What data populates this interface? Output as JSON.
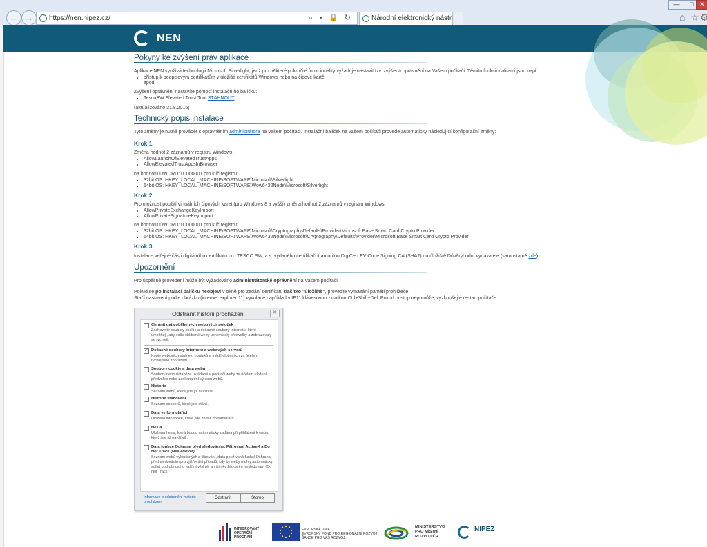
{
  "browser": {
    "url": "https://nen.nipez.cz/",
    "tab_title": "Národní elektronický nástroj",
    "tab_close": "×",
    "address_tools": "⌕ ▾ 🔒 ↻",
    "win_min": "—",
    "win_max": "□",
    "win_close": "✕",
    "back_glyph": "←",
    "forward_glyph": "→"
  },
  "header": {
    "logo_text": "NEN"
  },
  "section1": {
    "title": "Pokyny ke zvýšení práv aplikace",
    "intro": "Aplikace NEN využívá technologii Microsoft Silverlight, jenž pro některé pokročilé funkcionality vyžaduje nastavit tzv. zvýšená oprávnění na Vašem počítači. Těmito funkcionalitami jsou např.",
    "bullet1_line1": "přístup k podpisovým certifikátům v úložišti certifikátů Windows nebo na čipové kartě",
    "bullet1_line2": "apod.",
    "install_text": "Zvýšení oprávnění nastavíte pomocí instalačního balíčku:",
    "tool_text": "TescoSW Elevated Trust Tool ",
    "download_link": "STÁHNOUT",
    "updated": "(aktualizováno 31.8.2016)"
  },
  "section2": {
    "title": "Technický popis instalace",
    "intro_before": "Tyto změny je nutné provádět s oprávněním ",
    "intro_link": "administrátora",
    "intro_after": " na Vašem počítači. Instalační balíček na vašem počítači provede automaticky následující konfigurační změny:",
    "step1": {
      "title": "Krok 1",
      "text": "Změna hodnot 2 záznamů v registru Windows:",
      "items": [
        "AllowLaunchOfElevatedTrustApps",
        "AllowElevatedTrustAppsInBrowser"
      ],
      "value_text": "na hodnotu DWORD: 00000001 pro klíč registru:",
      "keys": [
        "32bit OS: HKEY_LOCAL_MACHINE\\SOFTWARE\\Microsoft\\Silverlight",
        "64bit OS: HKEY_LOCAL_MACHINE\\SOFTWARE\\Wow6432Node\\Microsoft\\Silverlight"
      ]
    },
    "step2": {
      "title": "Krok 2",
      "text": "Pro možnost použití virtuálních čipových karet (pro Windows 8 a vyšší) změna hodnot 2 záznamů v registru Windows:",
      "items": [
        "AllowPrivateExchangeKeyImport",
        "AllowPrivateSignatureKeyImport"
      ],
      "value_text": "na hodnotu DWORD: 00000001 pro klíč registru:",
      "keys": [
        "32bit OS: HKEY_LOCAL_MACHINE\\SOFTWARE\\Microsoft\\Cryptography\\Defaults\\Provider\\Microsoft Base Smart Card Crypto Provider",
        "64bit OS: HKEY_LOCAL_MACHINE\\SOFTWARE\\Wow6432Node\\Microsoft\\Cryptography\\Defaults\\Provider\\Microsoft Base Smart Card Crypto Provider"
      ]
    },
    "step3": {
      "title": "Krok 3",
      "text_before": "Instalace veřejné části digitálního certifikátu pro TESCO SW, a.s. vydaného certifikační autoritou DigiCert EV Code Signing CA (SHA2) do úložiště Důvěryhodní vydavatelé (samostatně ",
      "link": "zde",
      "text_after": ")."
    }
  },
  "section3": {
    "title": "Upozornění",
    "p1_before": "Pro úspěšné provedení může být vyžadováno ",
    "p1_bold": "administrátorské oprávnění",
    "p1_after": " na Vašem počítači.",
    "p2_a": "Pokud se ",
    "p2_bold1": "po instalaci balíčku neobjeví",
    "p2_b": " v okně pro zadání certifikátu ",
    "p2_bold2": "tlačítko \"úložiště\"",
    "p2_c": ", proveďte vymazání paměti prohlížeče.",
    "p3": "Stačí nastavení podle obrázku (internet explorer 11) vyvolané například v IE11 klávesovou zkratkou Ctrl+Shift+Del. Pokud postup nepomůže, vyzkoušejte restart počítače."
  },
  "dialog": {
    "title": "Odstranit historii procházení",
    "close": "✕",
    "options": [
      {
        "label": "Chránit data oblíbených webových položek",
        "checked": false,
        "desc": "Zachovejte soubory cookie a dočasné soubory Internetu, které umožňují, aby vaše oblíbené weby uchovávaly předvolby a zobrazovaly se rychleji."
      },
      {
        "label": "Dočasné soubory Internetu a webových serverů",
        "checked": true,
        "desc": "Kopie webových stránek, obrázků a médií uložených za účelem rychlejšího zobrazení."
      },
      {
        "label": "Soubory cookie a data webu",
        "checked": false,
        "desc": "Soubory nebo databáze ukládané v počítači weby za účelem uložení předvoleb nebo zdokonalení výkonu webů."
      },
      {
        "label": "Historie",
        "checked": false,
        "desc": "Seznam webů, které jste již navštívili."
      },
      {
        "label": "Historie stahování",
        "checked": false,
        "desc": "Seznam souborů, které jste stáhli."
      },
      {
        "label": "Data ve formulářích",
        "checked": false,
        "desc": "Uložené informace, které jste zadali do formulářů."
      },
      {
        "label": "Hesla",
        "checked": false,
        "desc": "Uložená hesla, která budou automaticky zadána při přihlášení k webu, který jste již navštívili."
      },
      {
        "label": "Data funkce Ochrana před sledováním, Filtrování ActiveX a Do Not Track (Nesledovat)",
        "checked": false,
        "desc": "Seznam webů vyloučených z filtrování, data používaná funkcí Ochrana před sledováním pro zjišťování případů, kdy by weby mohly automaticky sdílet podrobnosti o vaší návštěvě, a výjimky žádostí o nesledování (Do Not Track)"
      }
    ],
    "info_link": "Informace o odstranění historie procházení",
    "delete_button": "Odstranit",
    "cancel_button": "Storno"
  },
  "footer": {
    "iop_line1": "INTEGROVANÝ",
    "iop_line2": "OPERAČNÍ",
    "iop_line3": "PROGRAM",
    "eu_line1": "EVROPSKÁ UNIE",
    "eu_line2": "EVROPSKÝ FOND PRO REGIONÁLNÍ ROZVOJ",
    "eu_line3": "ŠANCE PRO VÁŠ ROZVOJ",
    "mmr_line1": "MINISTERSTVO",
    "mmr_line2": "PRO MÍSTNÍ",
    "mmr_line3": "ROZVOJ ČR",
    "nipez": "NIPEZ"
  },
  "colors": {
    "header": "#125a79",
    "heading": "#1b5068",
    "link": "#1c64b4"
  }
}
